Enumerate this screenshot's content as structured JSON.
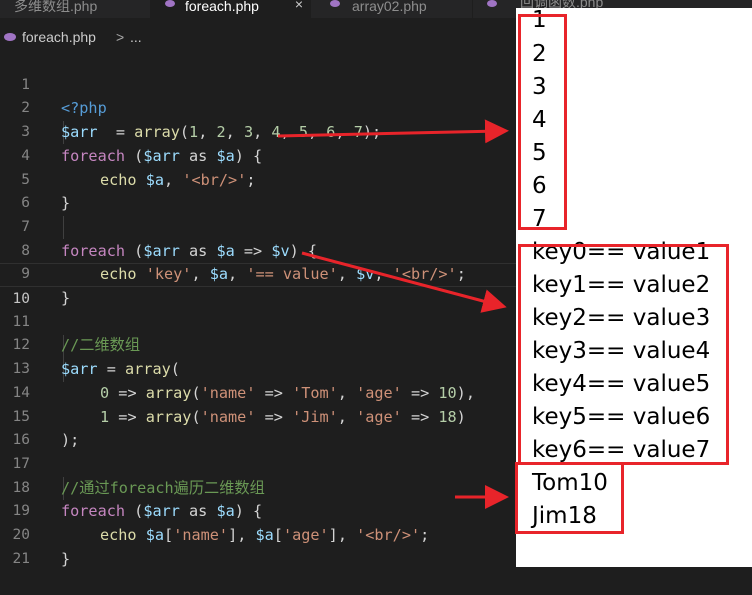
{
  "tabs": [
    {
      "label": "多维数组.php",
      "active": false
    },
    {
      "label": "foreach.php",
      "active": true
    },
    {
      "label": "array02.php",
      "active": false
    },
    {
      "label": "回调函数.php",
      "active": false
    }
  ],
  "breadcrumb": {
    "file": "foreach.php",
    "separator": ">",
    "more": "..."
  },
  "lines": [
    {
      "n": "1"
    },
    {
      "n": "2"
    },
    {
      "n": "3"
    },
    {
      "n": "4"
    },
    {
      "n": "5"
    },
    {
      "n": "6"
    },
    {
      "n": "7"
    },
    {
      "n": "8"
    },
    {
      "n": "9"
    },
    {
      "n": "10"
    },
    {
      "n": "11"
    },
    {
      "n": "12"
    },
    {
      "n": "13"
    },
    {
      "n": "14"
    },
    {
      "n": "15"
    },
    {
      "n": "16"
    },
    {
      "n": "17"
    },
    {
      "n": "18"
    },
    {
      "n": "19"
    },
    {
      "n": "20"
    },
    {
      "n": "21"
    }
  ],
  "code": {
    "l1": "<?php",
    "l2": [
      "$arr",
      "  = ",
      "array",
      "(",
      "1",
      ", ",
      "2",
      ", ",
      "3",
      ", ",
      "4",
      ", ",
      "5",
      ", ",
      "6",
      ", ",
      "7",
      ");"
    ],
    "l3": [
      "foreach",
      " (",
      "$arr",
      " as ",
      "$a",
      ") {"
    ],
    "l4": [
      "echo",
      " ",
      "$a",
      ", ",
      "'<br/>'",
      ";"
    ],
    "l5": "}",
    "l7": [
      "foreach",
      " (",
      "$arr",
      " as ",
      "$a",
      " => ",
      "$v",
      ") {"
    ],
    "l8": [
      "echo",
      " ",
      "'key'",
      ", ",
      "$a",
      ", ",
      "'== value'",
      ", ",
      "$v",
      ", ",
      "'<br/>'",
      ";"
    ],
    "l9": "}",
    "l11": "//二维数组",
    "l12": [
      "$arr",
      " = ",
      "array",
      "("
    ],
    "l13": [
      "0",
      " => ",
      "array",
      "(",
      "'name'",
      " => ",
      "'Tom'",
      ", ",
      "'age'",
      " => ",
      "10",
      "),"
    ],
    "l14": [
      "1",
      " => ",
      "array",
      "(",
      "'name'",
      " => ",
      "'Jim'",
      ", ",
      "'age'",
      " => ",
      "18",
      ")"
    ],
    "l15": ");",
    "l17": "//通过foreach遍历二维数组",
    "l18": [
      "foreach",
      " (",
      "$arr",
      " as ",
      "$a",
      ") {"
    ],
    "l19": [
      "echo",
      " ",
      "$a",
      "[",
      "'name'",
      "], ",
      "$a",
      "[",
      "'age'",
      "], ",
      "'<br/>'",
      ";"
    ],
    "l20": "}"
  },
  "output": {
    "header_text": "回调函数.php",
    "numbers": [
      "1",
      "2",
      "3",
      "4",
      "5",
      "6",
      "7"
    ],
    "key_values": [
      "key0== value1",
      "key1== value2",
      "key2== value3",
      "key3== value4",
      "key4== value5",
      "key5== value6",
      "key6== value7"
    ],
    "people": [
      "Tom10",
      "Jim18"
    ]
  },
  "colors": {
    "annotation": "#e8242a",
    "editor_bg": "#1e1e1e",
    "output_bg": "#ffffff"
  }
}
